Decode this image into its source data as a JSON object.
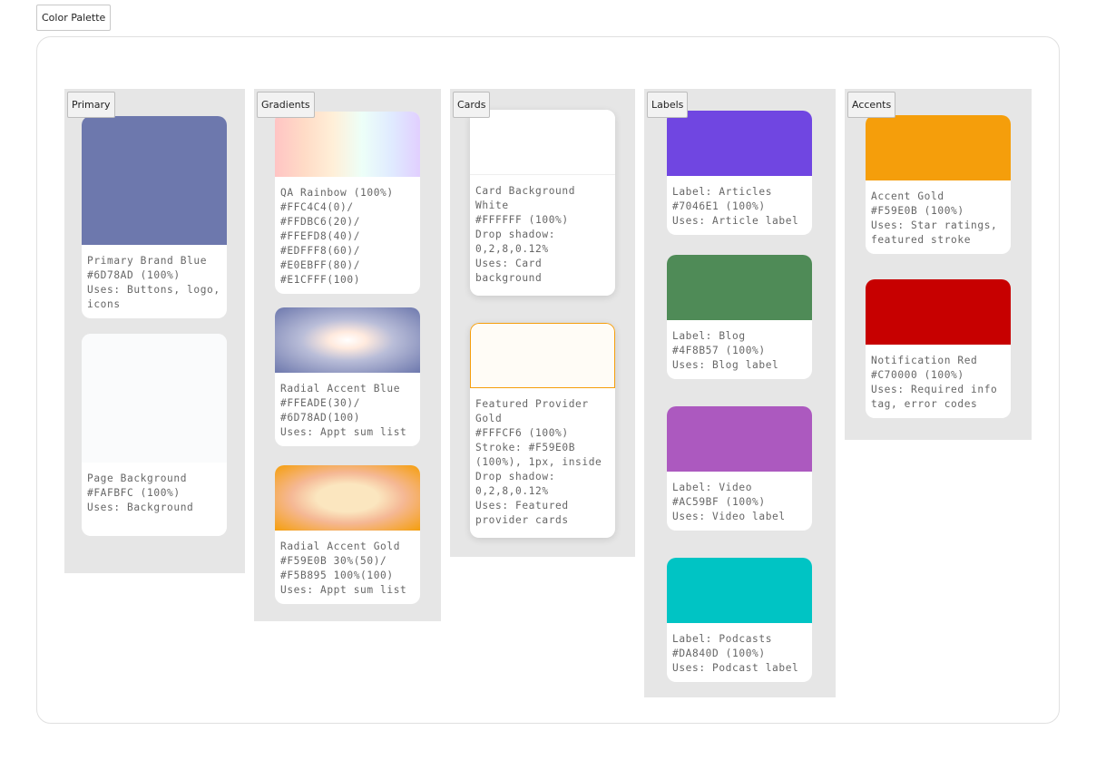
{
  "frame": {
    "title": "Color Palette"
  },
  "groups": {
    "primary": {
      "label": "Primary",
      "cards": [
        {
          "color": "#6D78AD",
          "lines": [
            "Primary Brand Blue",
            "#6D78AD (100%)",
            "Uses: Buttons, logo,",
            "icons"
          ]
        },
        {
          "color": "#FAFBFC",
          "lines": [
            "Page Background",
            "#FAFBFC (100%)",
            "Uses: Background"
          ]
        }
      ]
    },
    "gradients": {
      "label": "Gradients",
      "cards": [
        {
          "colors": [
            "#FFC4C4",
            "#FFDBC6",
            "#FFEFD8",
            "#EDFFF8",
            "#E0EBFF",
            "#E1CFFF"
          ],
          "lines": [
            "QA Rainbow (100%)",
            "#FFC4C4(0)/",
            "#FFDBC6(20)/",
            "#FFEFD8(40)/",
            "#EDFFF8(60)/",
            "#E0EBFF(80)/",
            "#E1CFFF(100)"
          ]
        },
        {
          "colors": [
            "#FFEADE",
            "#6D78AD"
          ],
          "lines": [
            "Radial Accent Blue",
            "#FFEADE(30)/",
            "#6D78AD(100)",
            "Uses: Appt sum list"
          ]
        },
        {
          "colors": [
            "#FBE6BF",
            "#F5B895",
            "#F59E0B"
          ],
          "lines": [
            "Radial Accent Gold",
            "#F59E0B 30%(50)/",
            "#F5B895 100%(100)",
            "Uses: Appt sum list"
          ]
        }
      ]
    },
    "cards": {
      "label": "Cards",
      "cards": [
        {
          "color": "#FFFFFF",
          "lines": [
            "Card Background",
            "White",
            "#FFFFFF (100%)",
            "Drop shadow:",
            "0,2,8,0.12%",
            "Uses: Card",
            "background"
          ]
        },
        {
          "color": "#FFFCF6",
          "stroke": "#F59E0B",
          "lines": [
            "Featured Provider",
            "Gold",
            "#FFFCF6 (100%)",
            "Stroke: #F59E0B",
            "(100%), 1px, inside",
            "Drop shadow:",
            "0,2,8,0.12%",
            "Uses: Featured",
            "provider cards"
          ]
        }
      ]
    },
    "labels": {
      "label": "Labels",
      "cards": [
        {
          "color": "#7046E1",
          "lines": [
            "Label: Articles",
            "#7046E1 (100%)",
            "Uses: Article label"
          ]
        },
        {
          "color": "#4F8B57",
          "lines": [
            "Label: Blog",
            "#4F8B57 (100%)",
            "Uses: Blog label"
          ]
        },
        {
          "color": "#AC59BF",
          "lines": [
            "Label: Video",
            "#AC59BF (100%)",
            "Uses: Video label"
          ]
        },
        {
          "color": "#00C4C4",
          "lines": [
            "Label: Podcasts",
            "#DA840D (100%)",
            "Uses: Podcast label"
          ]
        }
      ]
    },
    "accents": {
      "label": "Accents",
      "cards": [
        {
          "color": "#F59E0B",
          "lines": [
            "Accent Gold",
            "#F59E0B (100%)",
            "Uses: Star ratings,",
            "featured stroke"
          ]
        },
        {
          "color": "#C70000",
          "lines": [
            "Notification Red",
            "#C70000 (100%)",
            "Uses: Required info",
            "tag, error codes"
          ]
        }
      ]
    }
  }
}
